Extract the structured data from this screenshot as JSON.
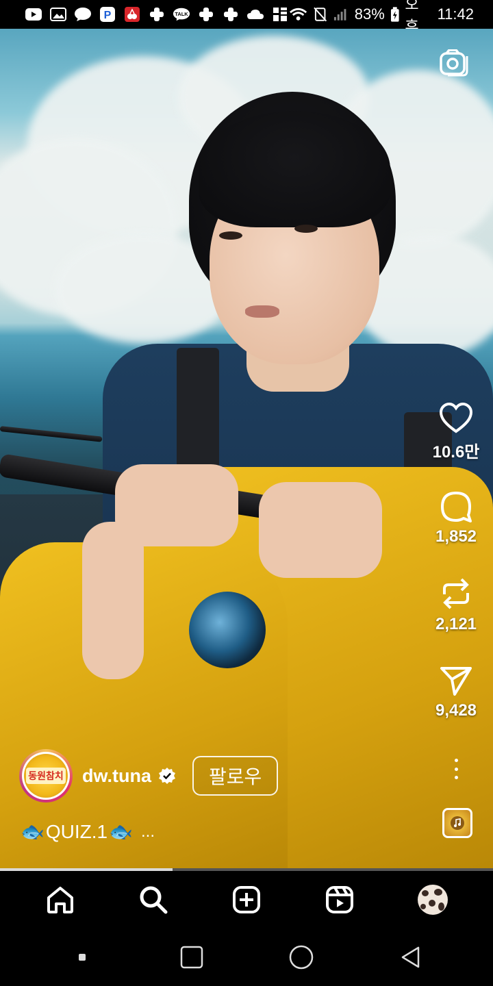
{
  "status_bar": {
    "battery": "83%",
    "time_period": "오후",
    "time": "11:42",
    "notification_icons": [
      "youtube-icon",
      "gallery-icon",
      "chat-bubble-icon",
      "p-app-icon",
      "cherry-app-icon",
      "plus-app-icon",
      "kakaotalk-icon",
      "plus-app-icon",
      "plus-app-icon",
      "cloud-icon",
      "grid-app-icon"
    ],
    "right_icons": [
      "wifi-icon",
      "nfc-mute-icon",
      "signal-icon",
      "battery-icon"
    ]
  },
  "reel": {
    "camera_icon": "camera-icon",
    "likes": "10.6만",
    "comments": "1,852",
    "reposts": "2,121",
    "shares": "9,428",
    "username": "dw.tuna",
    "avatar_text": "동원참치",
    "follow_label": "팔로우",
    "caption": "QUIZ.1",
    "caption_more": "...",
    "caption_emoji": "🐟",
    "progress": 0.35
  },
  "bottom_nav": {
    "items": [
      "home-icon",
      "search-icon",
      "create-icon",
      "reels-icon",
      "profile-avatar"
    ]
  },
  "system_nav": {
    "items": [
      "recent-apps",
      "home",
      "back"
    ]
  },
  "colors": {
    "background": "#000000",
    "overalls": "#E5B21A",
    "shirt": "#1E3E5E"
  }
}
